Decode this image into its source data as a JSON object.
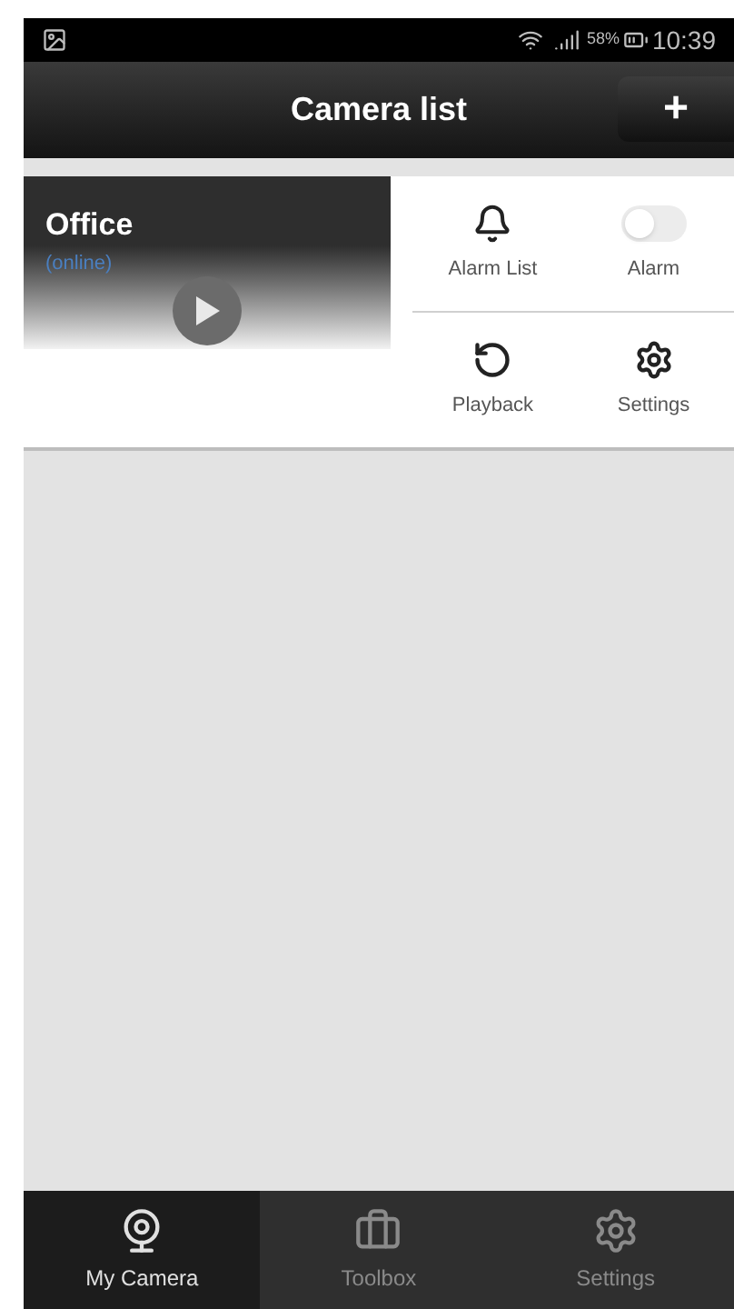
{
  "status_bar": {
    "battery_percent": "58%",
    "time": "10:39"
  },
  "header": {
    "title": "Camera list",
    "add_button": "+"
  },
  "cameras": [
    {
      "name": "Office",
      "status": "(online)",
      "actions": [
        {
          "kind": "alarm_list",
          "label": "Alarm List"
        },
        {
          "kind": "alarm_toggle",
          "label": "Alarm",
          "on": false
        },
        {
          "kind": "playback",
          "label": "Playback"
        },
        {
          "kind": "settings",
          "label": "Settings"
        }
      ]
    }
  ],
  "tabs": [
    {
      "kind": "camera",
      "label": "My Camera",
      "selected": true
    },
    {
      "kind": "toolbox",
      "label": "Toolbox",
      "selected": false
    },
    {
      "kind": "settings",
      "label": "Settings",
      "selected": false
    }
  ]
}
